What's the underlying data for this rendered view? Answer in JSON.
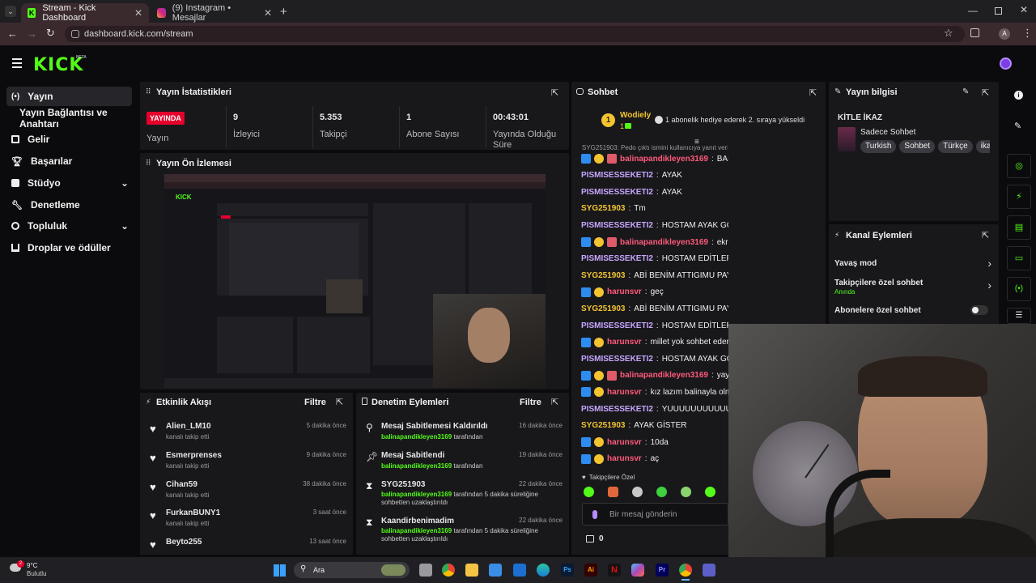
{
  "browser": {
    "tabs": [
      {
        "label": "Stream - Kick Dashboard",
        "active": true
      },
      {
        "label": "(9) Instagram • Mesajlar",
        "active": false
      }
    ],
    "url": "dashboard.kick.com/stream",
    "profile_initial": "A"
  },
  "app": {
    "logo": "KICK",
    "logo_badge": "BETA"
  },
  "sidebar": {
    "items": [
      {
        "label": "Yayın",
        "icon": "broadcast-icon"
      },
      {
        "label": "Yayın Bağlantısı ve Anahtarı",
        "icon": ""
      },
      {
        "label": "Gelir",
        "icon": "revenue-icon"
      },
      {
        "label": "Başarılar",
        "icon": "trophy-icon"
      },
      {
        "label": "Stüdyo",
        "icon": "studio-icon"
      },
      {
        "label": "Denetleme",
        "icon": "wrench-icon"
      },
      {
        "label": "Topluluk",
        "icon": "community-icon"
      },
      {
        "label": "Droplar ve ödüller",
        "icon": "drops-icon"
      }
    ]
  },
  "stats": {
    "title": "Yayın İstatistikleri",
    "live_badge": "YAYINDA",
    "cells": [
      {
        "value": "",
        "label": "Yayın"
      },
      {
        "value": "9",
        "label": "İzleyici"
      },
      {
        "value": "5.353",
        "label": "Takipçi"
      },
      {
        "value": "1",
        "label": "Abone Sayısı"
      },
      {
        "value": "00:43:01",
        "label": "Yayında Olduğu Süre"
      }
    ]
  },
  "preview": {
    "title": "Yayın Ön İzlemesi"
  },
  "activity": {
    "title": "Etkinlik Akışı",
    "filter": "Filtre",
    "items": [
      {
        "name": "Alien_LM10",
        "sub": "kanalı takip etti",
        "time": "5 dakika önce"
      },
      {
        "name": "Esmerprenses",
        "sub": "kanalı takip etti",
        "time": "9 dakika önce"
      },
      {
        "name": "Cihan59",
        "sub": "kanalı takip etti",
        "time": "38 dakika önce"
      },
      {
        "name": "FurkanBUNY1",
        "sub": "kanalı takip etti",
        "time": "3 saat önce"
      },
      {
        "name": "Beyto255",
        "sub": "kanalı takip etti",
        "time": "13 saat önce"
      }
    ]
  },
  "moderation": {
    "title": "Denetim Eylemleri",
    "filter": "Filtre",
    "items": [
      {
        "title": "Mesaj Sabitlemesi Kaldırıldı",
        "user": "balinapandikleyen3169",
        "rest": " tarafından",
        "time": "16 dakika önce",
        "icon": "unpin-icon"
      },
      {
        "title": "Mesaj Sabitlendi",
        "user": "balinapandikleyen3169",
        "rest": " tarafından",
        "time": "19 dakika önce",
        "icon": "pin-icon"
      },
      {
        "title": "SYG251903",
        "user": "balinapandikleyen3169",
        "rest": " tarafından 5 dakika süreliğine sohbetten uzaklaştırıldı",
        "time": "22 dakika önce",
        "icon": "hourglass-icon"
      },
      {
        "title": "Kaandirbenimadim",
        "user": "balinapandikleyen3169",
        "rest": " tarafından 5 dakika süreliğine sohbetten uzaklaştırıldı",
        "time": "22 dakika önce",
        "icon": "hourglass-icon"
      }
    ]
  },
  "chat": {
    "title": "Sohbet",
    "top_gifter": {
      "rank": "1",
      "name": "Wodiely",
      "count": "1"
    },
    "gift_text": "1 abonelik hediye ederek 2. sıraya yükseldi",
    "reply_hint": "SYG251903: Pedo çıktı ismini kullanıcıya yanıt veriyor",
    "messages": [
      {
        "user": "balinapandikleyen3169",
        "text": "BANANE",
        "color": "#ff5a7a",
        "badges": [
          "mod",
          "sub",
          "gift"
        ]
      },
      {
        "user": "PISMISESSEKETI2",
        "text": "AYAK",
        "color": "#c7a6ff",
        "badges": []
      },
      {
        "user": "PISMISESSEKETI2",
        "text": "AYAK",
        "color": "#c7a6ff",
        "badges": []
      },
      {
        "user": "SYG251903",
        "text": "Tm",
        "color": "#f4c430",
        "badges": []
      },
      {
        "user": "PISMISESSEKETI2",
        "text": "HOSTAM AYAK GÖSTER",
        "color": "#c7a6ff",
        "badges": []
      },
      {
        "user": "balinapandikleyen3169",
        "text": "ekranı kapa geç ?",
        "color": "#ff5a7a",
        "badges": [
          "mod",
          "sub",
          "gift"
        ]
      },
      {
        "user": "PISMISESSEKETI2",
        "text": "HOSTAM EDİTLERİ İZLE",
        "color": "#c7a6ff",
        "badges": []
      },
      {
        "user": "SYG251903",
        "text": "ABİ BENİM ATTIGIMU PAYLASACAKTİN",
        "color": "#f4c430",
        "badges": []
      },
      {
        "user": "harunsvr",
        "text": "geç",
        "color": "#ff5a7a",
        "badges": [
          "mod",
          "sub"
        ]
      },
      {
        "user": "SYG251903",
        "text": "ABİ BENİM ATTIGIMU PAYLASACAKTİN",
        "color": "#f4c430",
        "badges": []
      },
      {
        "user": "PISMISESSEKETI2",
        "text": "HOSTAM EDİTLER",
        "color": "#c7a6ff",
        "badges": []
      },
      {
        "user": "harunsvr",
        "text": "millet yok sohbet edemiyor",
        "color": "#ff5a7a",
        "badges": [
          "mod",
          "sub"
        ]
      },
      {
        "user": "PISMISESSEKETI2",
        "text": "HOSTAM AYAK GÖSTER",
        "color": "#c7a6ff",
        "badges": []
      },
      {
        "user": "balinapandikleyen3169",
        "text": "yayınları",
        "color": "#ff5a7a",
        "badges": [
          "mod",
          "sub",
          "gift"
        ]
      },
      {
        "user": "harunsvr",
        "text": "kız lazım balinayla olmuyor",
        "color": "#ff5a7a",
        "badges": [
          "mod",
          "sub"
        ]
      },
      {
        "user": "PISMISESSEKETI2",
        "text": "YUUUUUUUUUUUUUUU",
        "color": "#c7a6ff",
        "badges": []
      },
      {
        "user": "SYG251903",
        "text": "AYAK GİSTER",
        "color": "#f4c430",
        "badges": []
      },
      {
        "user": "harunsvr",
        "text": "10da",
        "color": "#ff5a7a",
        "badges": [
          "mod",
          "sub"
        ]
      },
      {
        "user": "harunsvr",
        "text": "aç",
        "color": "#ff5a7a",
        "badges": [
          "mod",
          "sub"
        ]
      }
    ],
    "followers_only": "Takipçilere Özel",
    "input_placeholder": "Bir mesaj gönderin",
    "points": "0"
  },
  "stream_info": {
    "title": "Yayın bilgisi",
    "stream_title": "KİTLE İKAZ",
    "category": "Sadece Sohbet",
    "tags": [
      "Turkish",
      "Sohbet",
      "Türkçe",
      "ika"
    ]
  },
  "channel_actions": {
    "title": "Kanal Eylemleri",
    "items": [
      {
        "label": "Yavaş mod",
        "sub": ""
      },
      {
        "label": "Takipçilere özel sohbet",
        "sub": "Anında"
      },
      {
        "label": "Abonelere özel sohbet",
        "sub": ""
      }
    ]
  },
  "taskbar": {
    "weather_temp": "9°C",
    "weather_label": "Bulutlu",
    "weather_badge": "2",
    "search": "Ara"
  },
  "colors": {
    "brand": "#53fc18",
    "live": "#e5002b",
    "panel": "#18181b"
  }
}
